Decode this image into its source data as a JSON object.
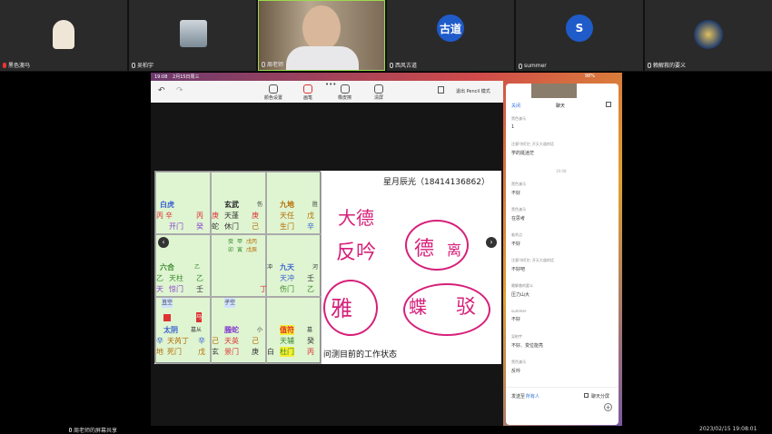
{
  "participants": [
    {
      "name": "黑色澳马",
      "avatar": "photo-woman"
    },
    {
      "name": "吴柏宇",
      "avatar": "photo-landscape"
    },
    {
      "name": "周老师",
      "avatar": "photo-man"
    },
    {
      "name": "西风古道",
      "initials": "古道",
      "color": "#1f5bc9"
    },
    {
      "name": "summer",
      "initials": "S",
      "color": "#1f5bc9"
    },
    {
      "name": "赖解救的要义",
      "avatar": "photo-emblem"
    }
  ],
  "status_bar": {
    "time": "19:08",
    "date": "2月15日周三",
    "battery": "98%"
  },
  "toolbar": {
    "undo": "undo",
    "redo": "redo",
    "palette_label": "颜色设置",
    "pen_label": "画笔",
    "eraser_label": "橡皮擦",
    "clear_label": "清屏",
    "exit_label": "退出 Pencil 模式"
  },
  "slide": {
    "header": "星月辰光（18414136862）",
    "caption": "问测目前的工作状态",
    "handwriting": [
      "大德",
      "反吟",
      "德",
      "离",
      "雅",
      "蝶",
      "驳"
    ],
    "grid": [
      {
        "name": "白虎",
        "outer": "丙",
        "row1": [
          "丙",
          "辛",
          "丙"
        ],
        "row2": [
          "",
          "开门",
          "癸"
        ],
        "small": "勾"
      },
      {
        "name": "玄武",
        "corner": "伤",
        "row1": [
          "庚",
          "天蓬",
          "庚"
        ],
        "row2": [
          "蛇",
          "休门",
          "己"
        ]
      },
      {
        "name": "九地",
        "corner": "胜",
        "row1": [
          "戊",
          "天任",
          "戊"
        ],
        "row2": [
          "阴",
          "生门",
          "辛"
        ]
      },
      {
        "name": "六合",
        "corner": "乙",
        "row1": [
          "乙",
          "天柱",
          "乙"
        ],
        "row2": [
          "天",
          "惊门",
          "壬"
        ]
      },
      {
        "name": "center",
        "row1": [
          "癸",
          "甲",
          "戊丙"
        ],
        "row2": [
          "卯",
          "寅",
          "戊辰"
        ]
      },
      {
        "name": "九天",
        "corner": "河",
        "row1": [
          "",
          "天冲",
          "壬"
        ],
        "row2": [
          "丁",
          "伤门",
          "乙"
        ],
        "extra": "冲"
      },
      {
        "name": "太阴",
        "corner": "墓从",
        "row1": [
          "辛",
          "天芮丁",
          "辛"
        ],
        "row2": [
          "地",
          "死门",
          "戊"
        ],
        "tag": "丑空",
        "top": "马"
      },
      {
        "name": "螣蛇",
        "corner": "小",
        "row1": [
          "己",
          "天英",
          "己"
        ],
        "row2": [
          "玄",
          "景门",
          "庚"
        ],
        "tag": "子空"
      },
      {
        "name": "值符",
        "corner": "墓",
        "row1": [
          "",
          "天辅",
          "癸"
        ],
        "row2": [
          "白",
          "杜门",
          "丙"
        ]
      }
    ]
  },
  "chat": {
    "close_label": "关闭",
    "title": "聊天",
    "messages": [
      {
        "from": "黑色澳马",
        "text": "1"
      },
      {
        "from": "注意!你们仨 开天大道的话",
        "text": "学的挺迷茫"
      },
      {
        "from": "黑色澳马",
        "text": "不好"
      },
      {
        "from": "黑色澳马",
        "text": "在思考"
      },
      {
        "from": "临秀点",
        "text": "不好"
      },
      {
        "from": "注意!你们仨 开天大道的话",
        "text": "不好吧"
      },
      {
        "from": "赖解救的要义",
        "text": "压力山大"
      },
      {
        "from": "summer",
        "text": "不好"
      },
      {
        "from": "吴柏宇",
        "text": "不好、变位能亮"
      },
      {
        "from": "黑色澳马",
        "text": "反吟"
      }
    ],
    "divider": "19:08",
    "send_to_label": "发送至",
    "send_to_value": "所有人",
    "split_label": "聊天分屏"
  },
  "bottom": {
    "left": "周老师的屏幕共享",
    "right": "2023/02/15 19:08:01"
  }
}
